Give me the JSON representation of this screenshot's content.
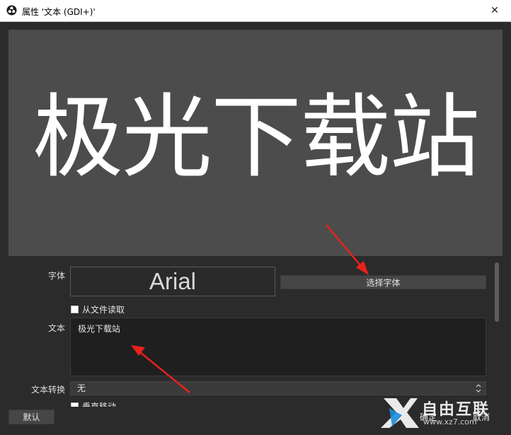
{
  "window": {
    "title": "属性 '文本 (GDI+)'",
    "close_glyph": "✕"
  },
  "preview": {
    "text": "极光下载站"
  },
  "font": {
    "label": "字体",
    "preview_name": "Arial",
    "select_button": "选择字体"
  },
  "read_from_file": {
    "label": "从文件读取",
    "checked": false
  },
  "text_field": {
    "label": "文本",
    "value": "极光下载站"
  },
  "text_transform": {
    "label": "文本转换",
    "selected": "无"
  },
  "vertical_move": {
    "label": "垂直移动",
    "checked": false
  },
  "footer": {
    "default_button": "默认",
    "ok_button": "确定",
    "cancel_button": "取消"
  },
  "watermark": {
    "text": "自由互联",
    "url": "www.xz7.com"
  },
  "colors": {
    "background": "#2b2b2b",
    "preview_bg": "#4c4c4c",
    "arrow": "#e8221b",
    "watermark_blue": "#1e8fdc"
  }
}
